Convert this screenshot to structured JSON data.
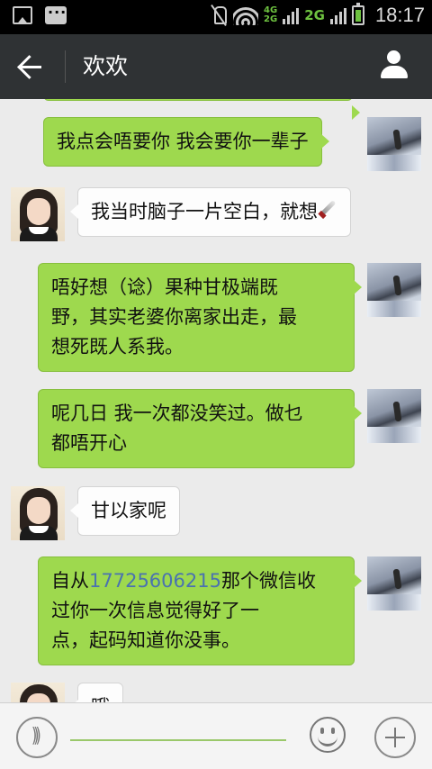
{
  "status_bar": {
    "network_top": "4G",
    "network_bottom": "2G",
    "network_label": "2G",
    "time": "18:17",
    "icons": [
      "gallery-icon",
      "message-icon",
      "mute-icon",
      "wifi-icon",
      "signal-icon",
      "battery-icon"
    ]
  },
  "header": {
    "title": "欢欢"
  },
  "messages": [
    {
      "side": "out",
      "text": "我点会唔要你 我会要你一辈子"
    },
    {
      "side": "in",
      "text": "我当时脑子一片空白，就想"
    },
    {
      "side": "out",
      "lines": [
        "唔好想（谂）果种甘极端既",
        "野，其实老婆你离家出走，最",
        "想死既人系我。"
      ]
    },
    {
      "side": "out",
      "lines": [
        "呢几日 我一次都没笑过。做乜",
        "都唔开心"
      ]
    },
    {
      "side": "in",
      "text": "甘以家呢"
    },
    {
      "side": "out",
      "line1_prefix": "自从",
      "phone": "17725606215",
      "line1_suffix": "那个微信收",
      "lines": [
        "过你一次信息觉得好了一",
        "点，起码知道你没事。"
      ]
    },
    {
      "side": "in",
      "text": "哦"
    }
  ],
  "colors": {
    "outgoing_bubble": "#9ed94e",
    "incoming_bubble": "#fdfdfd",
    "header_bg": "#2f3234",
    "link": "#4a72b0"
  }
}
